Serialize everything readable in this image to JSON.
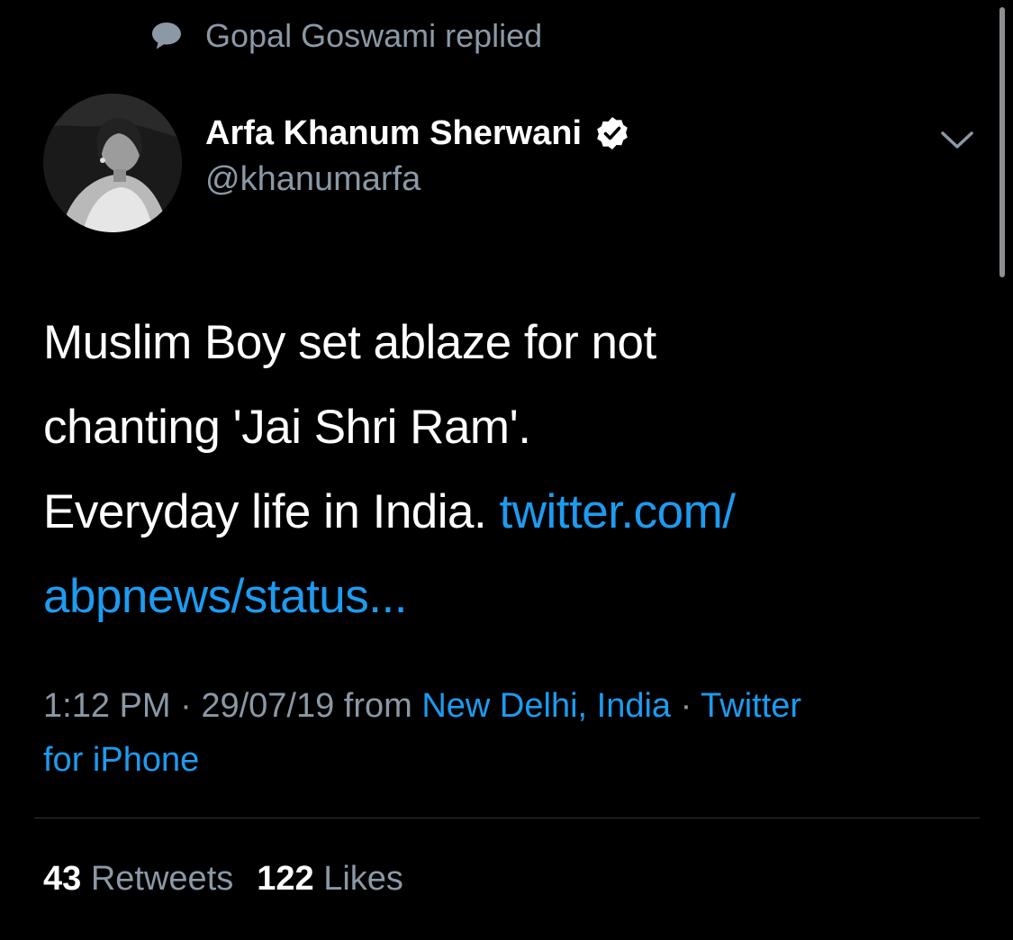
{
  "social_context": {
    "icon": "speech-bubble-icon",
    "text": "Gopal Goswami replied"
  },
  "author": {
    "display_name": "Arfa Khanum Sherwani",
    "handle": "@khanumarfa",
    "verified_icon": "verified-badge-icon",
    "avatar_icon": "profile-photo"
  },
  "menu": {
    "icon": "chevron-down-icon"
  },
  "tweet": {
    "line1": "Muslim Boy set ablaze for not",
    "line2": "chanting 'Jai Shri Ram'.",
    "line3_text": "Everyday life in India.",
    "link_part1": "twitter.com/",
    "link_part2": "abpnews/status..."
  },
  "meta": {
    "time": "1:12 PM",
    "separator": "·",
    "date": "29/07/19",
    "from": "from",
    "location": "New Delhi, India",
    "source_part1": "Twitter",
    "source_part2": "for iPhone"
  },
  "stats": {
    "retweets_count": "43",
    "retweets_label": "Retweets",
    "likes_count": "122",
    "likes_label": "Likes"
  },
  "colors": {
    "background": "#000000",
    "text_primary": "#ffffff",
    "text_secondary": "#8b98a5",
    "link": "#1d9bf0",
    "divider": "#2f3336"
  }
}
